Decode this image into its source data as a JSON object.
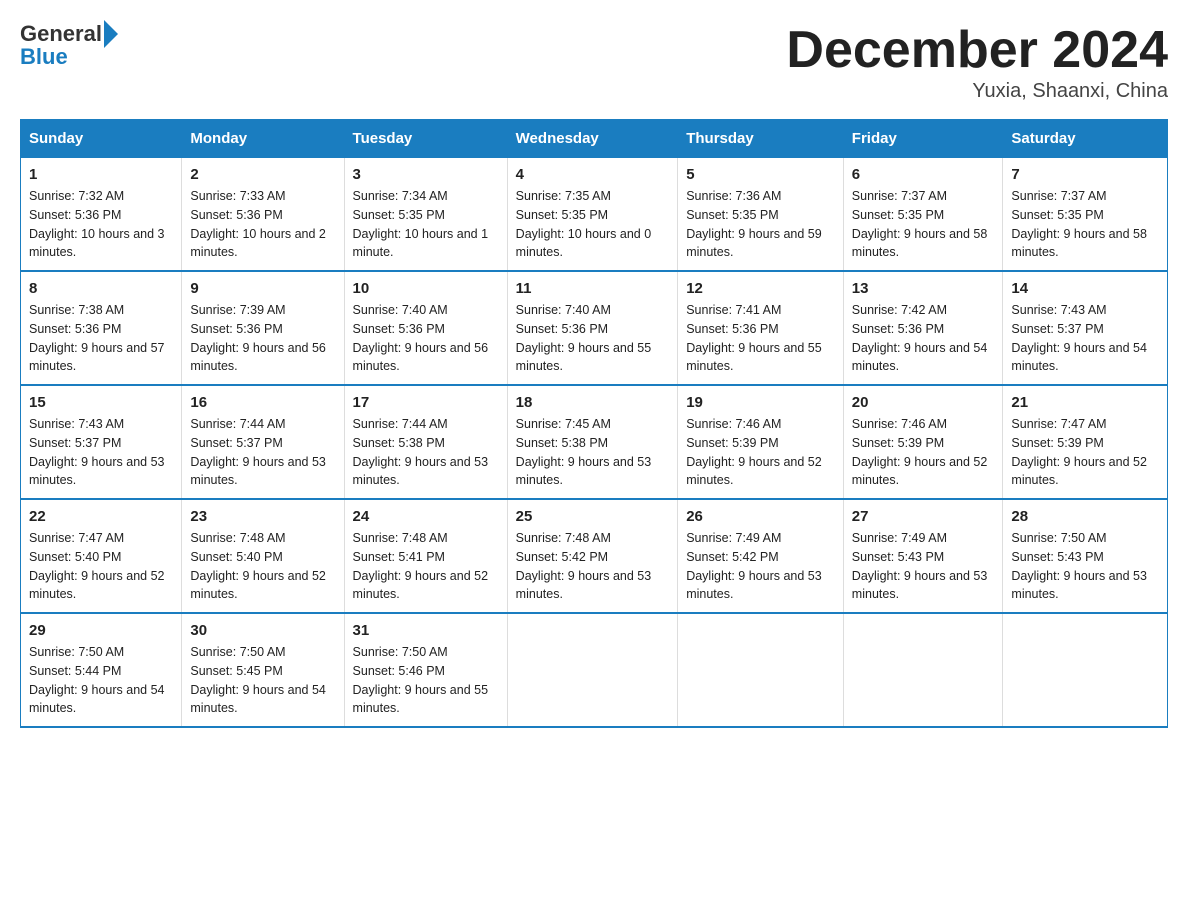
{
  "logo": {
    "general": "General",
    "blue": "Blue"
  },
  "header": {
    "title": "December 2024",
    "subtitle": "Yuxia, Shaanxi, China"
  },
  "weekdays": [
    "Sunday",
    "Monday",
    "Tuesday",
    "Wednesday",
    "Thursday",
    "Friday",
    "Saturday"
  ],
  "weeks": [
    [
      {
        "day": "1",
        "sunrise": "7:32 AM",
        "sunset": "5:36 PM",
        "daylight": "10 hours and 3 minutes."
      },
      {
        "day": "2",
        "sunrise": "7:33 AM",
        "sunset": "5:36 PM",
        "daylight": "10 hours and 2 minutes."
      },
      {
        "day": "3",
        "sunrise": "7:34 AM",
        "sunset": "5:35 PM",
        "daylight": "10 hours and 1 minute."
      },
      {
        "day": "4",
        "sunrise": "7:35 AM",
        "sunset": "5:35 PM",
        "daylight": "10 hours and 0 minutes."
      },
      {
        "day": "5",
        "sunrise": "7:36 AM",
        "sunset": "5:35 PM",
        "daylight": "9 hours and 59 minutes."
      },
      {
        "day": "6",
        "sunrise": "7:37 AM",
        "sunset": "5:35 PM",
        "daylight": "9 hours and 58 minutes."
      },
      {
        "day": "7",
        "sunrise": "7:37 AM",
        "sunset": "5:35 PM",
        "daylight": "9 hours and 58 minutes."
      }
    ],
    [
      {
        "day": "8",
        "sunrise": "7:38 AM",
        "sunset": "5:36 PM",
        "daylight": "9 hours and 57 minutes."
      },
      {
        "day": "9",
        "sunrise": "7:39 AM",
        "sunset": "5:36 PM",
        "daylight": "9 hours and 56 minutes."
      },
      {
        "day": "10",
        "sunrise": "7:40 AM",
        "sunset": "5:36 PM",
        "daylight": "9 hours and 56 minutes."
      },
      {
        "day": "11",
        "sunrise": "7:40 AM",
        "sunset": "5:36 PM",
        "daylight": "9 hours and 55 minutes."
      },
      {
        "day": "12",
        "sunrise": "7:41 AM",
        "sunset": "5:36 PM",
        "daylight": "9 hours and 55 minutes."
      },
      {
        "day": "13",
        "sunrise": "7:42 AM",
        "sunset": "5:36 PM",
        "daylight": "9 hours and 54 minutes."
      },
      {
        "day": "14",
        "sunrise": "7:43 AM",
        "sunset": "5:37 PM",
        "daylight": "9 hours and 54 minutes."
      }
    ],
    [
      {
        "day": "15",
        "sunrise": "7:43 AM",
        "sunset": "5:37 PM",
        "daylight": "9 hours and 53 minutes."
      },
      {
        "day": "16",
        "sunrise": "7:44 AM",
        "sunset": "5:37 PM",
        "daylight": "9 hours and 53 minutes."
      },
      {
        "day": "17",
        "sunrise": "7:44 AM",
        "sunset": "5:38 PM",
        "daylight": "9 hours and 53 minutes."
      },
      {
        "day": "18",
        "sunrise": "7:45 AM",
        "sunset": "5:38 PM",
        "daylight": "9 hours and 53 minutes."
      },
      {
        "day": "19",
        "sunrise": "7:46 AM",
        "sunset": "5:39 PM",
        "daylight": "9 hours and 52 minutes."
      },
      {
        "day": "20",
        "sunrise": "7:46 AM",
        "sunset": "5:39 PM",
        "daylight": "9 hours and 52 minutes."
      },
      {
        "day": "21",
        "sunrise": "7:47 AM",
        "sunset": "5:39 PM",
        "daylight": "9 hours and 52 minutes."
      }
    ],
    [
      {
        "day": "22",
        "sunrise": "7:47 AM",
        "sunset": "5:40 PM",
        "daylight": "9 hours and 52 minutes."
      },
      {
        "day": "23",
        "sunrise": "7:48 AM",
        "sunset": "5:40 PM",
        "daylight": "9 hours and 52 minutes."
      },
      {
        "day": "24",
        "sunrise": "7:48 AM",
        "sunset": "5:41 PM",
        "daylight": "9 hours and 52 minutes."
      },
      {
        "day": "25",
        "sunrise": "7:48 AM",
        "sunset": "5:42 PM",
        "daylight": "9 hours and 53 minutes."
      },
      {
        "day": "26",
        "sunrise": "7:49 AM",
        "sunset": "5:42 PM",
        "daylight": "9 hours and 53 minutes."
      },
      {
        "day": "27",
        "sunrise": "7:49 AM",
        "sunset": "5:43 PM",
        "daylight": "9 hours and 53 minutes."
      },
      {
        "day": "28",
        "sunrise": "7:50 AM",
        "sunset": "5:43 PM",
        "daylight": "9 hours and 53 minutes."
      }
    ],
    [
      {
        "day": "29",
        "sunrise": "7:50 AM",
        "sunset": "5:44 PM",
        "daylight": "9 hours and 54 minutes."
      },
      {
        "day": "30",
        "sunrise": "7:50 AM",
        "sunset": "5:45 PM",
        "daylight": "9 hours and 54 minutes."
      },
      {
        "day": "31",
        "sunrise": "7:50 AM",
        "sunset": "5:46 PM",
        "daylight": "9 hours and 55 minutes."
      },
      null,
      null,
      null,
      null
    ]
  ]
}
